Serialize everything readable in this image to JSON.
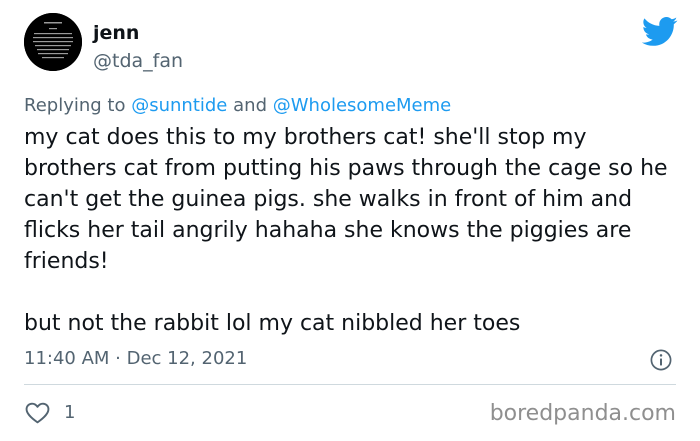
{
  "tweet": {
    "author": {
      "display_name": "jenn",
      "handle": "@tda_fan"
    },
    "reply": {
      "prefix": "Replying to",
      "mention_1": "@sunntide",
      "joiner": "and",
      "mention_2": "@WholesomeMeme"
    },
    "paragraphs": [
      "my cat does this to my brothers cat! she'll stop my brothers cat from putting his paws through the cage so he can't get the guinea pigs. she walks in front of him and flicks her tail angrily hahaha she knows the piggies are friends!",
      "but not the rabbit lol my cat nibbled her toes"
    ],
    "timestamp": "11:40 AM · Dec 12, 2021",
    "like_count": "1"
  },
  "watermark": "boredpanda.com",
  "icons": {
    "brand": "twitter-bird-icon",
    "info": "info-icon",
    "like": "heart-icon"
  },
  "colors": {
    "twitter_blue": "#1d9bf0",
    "muted_text": "#536471",
    "body_text": "#0f1419"
  }
}
